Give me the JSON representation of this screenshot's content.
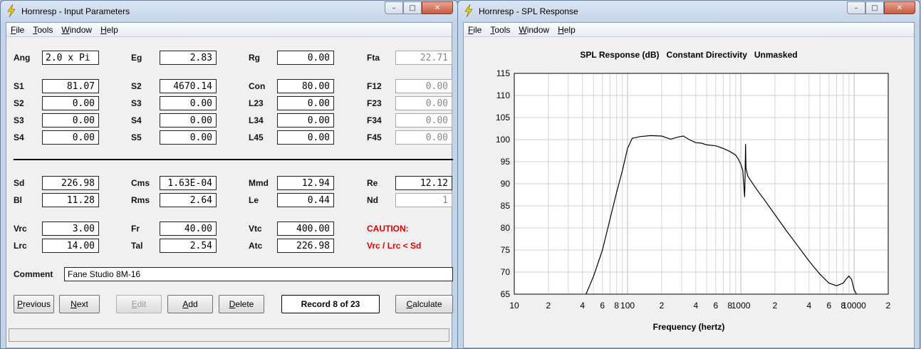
{
  "left_window": {
    "title": "Hornresp - Input Parameters",
    "icon": "lightning-bolt-icon",
    "menu": [
      {
        "u": "F",
        "rest": "ile"
      },
      {
        "u": "T",
        "rest": "ools"
      },
      {
        "u": "W",
        "rest": "indow"
      },
      {
        "u": "H",
        "rest": "elp"
      }
    ],
    "window_controls": {
      "minimize": "–",
      "maximize": "□",
      "close": "✕"
    },
    "params": {
      "ang": {
        "label": "Ang",
        "value": "2.0 x Pi"
      },
      "eg": {
        "label": "Eg",
        "value": "2.83"
      },
      "rg": {
        "label": "Rg",
        "value": "0.00"
      },
      "fta": {
        "label": "Fta",
        "value": "22.71"
      },
      "s1": {
        "label": "S1",
        "value": "81.07"
      },
      "s2a": {
        "label": "S2",
        "value": "4670.14"
      },
      "con": {
        "label": "Con",
        "value": "80.00"
      },
      "f12": {
        "label": "F12",
        "value": "0.00"
      },
      "s2b": {
        "label": "S2",
        "value": "0.00"
      },
      "s3a": {
        "label": "S3",
        "value": "0.00"
      },
      "l23": {
        "label": "L23",
        "value": "0.00"
      },
      "f23": {
        "label": "F23",
        "value": "0.00"
      },
      "s3b": {
        "label": "S3",
        "value": "0.00"
      },
      "s4a": {
        "label": "S4",
        "value": "0.00"
      },
      "l34": {
        "label": "L34",
        "value": "0.00"
      },
      "f34": {
        "label": "F34",
        "value": "0.00"
      },
      "s4b": {
        "label": "S4",
        "value": "0.00"
      },
      "s5": {
        "label": "S5",
        "value": "0.00"
      },
      "l45": {
        "label": "L45",
        "value": "0.00"
      },
      "f45": {
        "label": "F45",
        "value": "0.00"
      },
      "sd": {
        "label": "Sd",
        "value": "226.98"
      },
      "cms": {
        "label": "Cms",
        "value": "1.63E-04"
      },
      "mmd": {
        "label": "Mmd",
        "value": "12.94"
      },
      "re": {
        "label": "Re",
        "value": "12.12"
      },
      "bl": {
        "label": "Bl",
        "value": "11.28"
      },
      "rms": {
        "label": "Rms",
        "value": "2.64"
      },
      "le": {
        "label": "Le",
        "value": "0.44"
      },
      "nd": {
        "label": "Nd",
        "value": "1"
      },
      "vrc": {
        "label": "Vrc",
        "value": "3.00"
      },
      "fr": {
        "label": "Fr",
        "value": "40.00"
      },
      "vtc": {
        "label": "Vtc",
        "value": "400.00"
      },
      "lrc": {
        "label": "Lrc",
        "value": "14.00"
      },
      "tal": {
        "label": "Tal",
        "value": "2.54"
      },
      "atc": {
        "label": "Atc",
        "value": "226.98"
      }
    },
    "caution_title": "CAUTION:",
    "caution_text": "Vrc / Lrc < Sd",
    "comment_label": "Comment",
    "comment_value": "Fane Studio 8M-16",
    "buttons": {
      "previous": {
        "u": "P",
        "rest": "revious"
      },
      "next": {
        "u": "N",
        "rest": "ext"
      },
      "edit": {
        "u": "E",
        "rest": "dit"
      },
      "add": {
        "u": "A",
        "rest": "dd"
      },
      "delete": {
        "u": "D",
        "rest": "elete"
      },
      "record": "Record 8 of 23",
      "calculate": {
        "u": "C",
        "rest": "alculate"
      }
    }
  },
  "right_window": {
    "title": "Hornresp - SPL Response",
    "icon": "lightning-bolt-icon",
    "menu": [
      {
        "u": "F",
        "rest": "ile"
      },
      {
        "u": "T",
        "rest": "ools"
      },
      {
        "u": "W",
        "rest": "indow"
      },
      {
        "u": "H",
        "rest": "elp"
      }
    ],
    "window_controls": {
      "minimize": "–",
      "maximize": "□",
      "close": "✕"
    }
  },
  "chart_data": {
    "type": "line",
    "title": "SPL Response (dB)   Constant Directivity   Unmasked",
    "xlabel": "Frequency (hertz)",
    "ylabel": "",
    "x_scale": "log",
    "xlim": [
      10,
      20000
    ],
    "ylim": [
      65,
      115
    ],
    "y_ticks": [
      65,
      70,
      75,
      80,
      85,
      90,
      95,
      100,
      105,
      110,
      115
    ],
    "x_tick_labels": [
      {
        "x": 10,
        "label": "10"
      },
      {
        "x": 20,
        "label": "2"
      },
      {
        "x": 40,
        "label": "4"
      },
      {
        "x": 60,
        "label": "6"
      },
      {
        "x": 80,
        "label": "8"
      },
      {
        "x": 100,
        "label": "100"
      },
      {
        "x": 200,
        "label": "2"
      },
      {
        "x": 400,
        "label": "4"
      },
      {
        "x": 600,
        "label": "6"
      },
      {
        "x": 800,
        "label": "8"
      },
      {
        "x": 1000,
        "label": "1000"
      },
      {
        "x": 2000,
        "label": "2"
      },
      {
        "x": 4000,
        "label": "4"
      },
      {
        "x": 6000,
        "label": "6"
      },
      {
        "x": 8000,
        "label": "8"
      },
      {
        "x": 10000,
        "label": "10000"
      },
      {
        "x": 20000,
        "label": "2"
      }
    ],
    "grid": true,
    "series": [
      {
        "color": "#000000",
        "points": [
          [
            43,
            65
          ],
          [
            50,
            69
          ],
          [
            60,
            75
          ],
          [
            70,
            82
          ],
          [
            80,
            88
          ],
          [
            90,
            93
          ],
          [
            100,
            98
          ],
          [
            110,
            100.3
          ],
          [
            130,
            100.7
          ],
          [
            160,
            100.9
          ],
          [
            200,
            100.8
          ],
          [
            240,
            100.1
          ],
          [
            280,
            100.6
          ],
          [
            310,
            100.8
          ],
          [
            350,
            100.0
          ],
          [
            400,
            99.3
          ],
          [
            450,
            99.2
          ],
          [
            500,
            98.8
          ],
          [
            600,
            98.6
          ],
          [
            700,
            98.0
          ],
          [
            800,
            97.3
          ],
          [
            900,
            96.5
          ],
          [
            950,
            95.6
          ],
          [
            1000,
            94.4
          ],
          [
            1040,
            93.0
          ],
          [
            1080,
            87.0
          ],
          [
            1090,
            91.5
          ],
          [
            1100,
            99.0
          ],
          [
            1110,
            93.5
          ],
          [
            1150,
            91.8
          ],
          [
            1200,
            91.0
          ],
          [
            1400,
            88.5
          ],
          [
            1600,
            86.5
          ],
          [
            2000,
            83.0
          ],
          [
            2500,
            79.5
          ],
          [
            3000,
            76.8
          ],
          [
            4000,
            72.5
          ],
          [
            5000,
            69.5
          ],
          [
            6000,
            67.5
          ],
          [
            7000,
            66.9
          ],
          [
            8000,
            67.5
          ],
          [
            8500,
            68.4
          ],
          [
            9000,
            69.1
          ],
          [
            9500,
            68.3
          ],
          [
            10000,
            66.0
          ],
          [
            10500,
            65.0
          ]
        ]
      }
    ]
  }
}
